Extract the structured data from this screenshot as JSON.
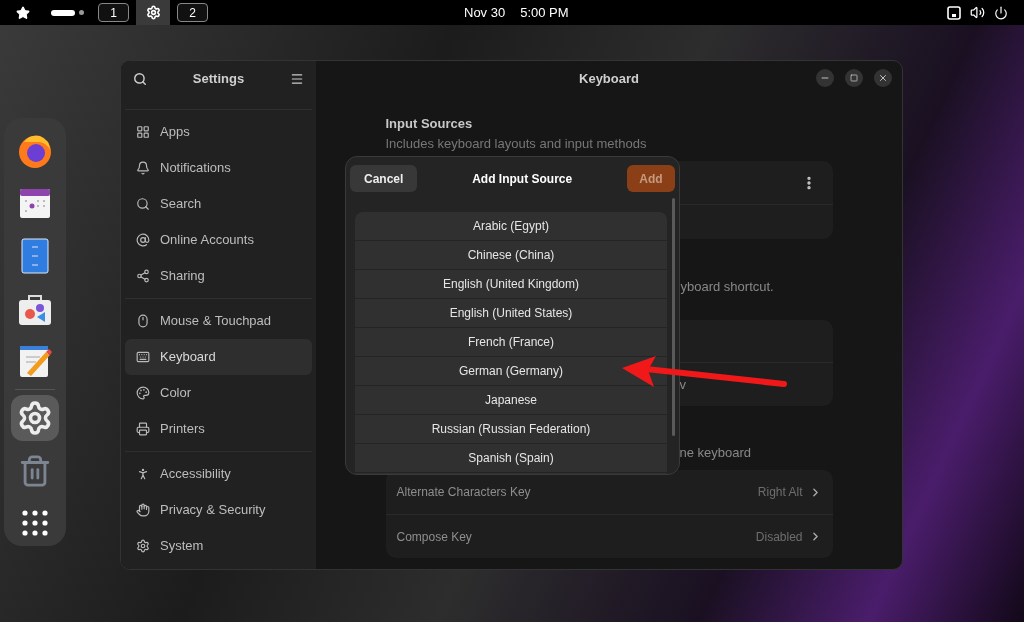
{
  "top_bar": {
    "workspace_dots": [
      {
        "selected": true
      },
      {
        "selected": false
      }
    ],
    "workspaces": [
      {
        "kind": "number",
        "label": "1",
        "selected": false
      },
      {
        "kind": "app",
        "selected": true
      },
      {
        "kind": "number",
        "label": "2",
        "selected": false
      }
    ],
    "date": "Nov 30",
    "time": "5:00 PM"
  },
  "dock": {
    "items": [
      {
        "kind": "browser",
        "selected": false
      },
      {
        "kind": "calendar",
        "selected": false
      },
      {
        "kind": "notes",
        "selected": false
      },
      {
        "kind": "store",
        "selected": false
      },
      {
        "kind": "editor",
        "selected": false
      },
      {
        "kind": "settings",
        "selected": true
      },
      {
        "kind": "trash",
        "selected": false
      },
      {
        "kind": "app-grid",
        "selected": false
      }
    ]
  },
  "sidebar": {
    "title": "Settings",
    "groups": [
      [
        {
          "label": "Apps",
          "kind": "apps",
          "selected": false
        },
        {
          "label": "Notifications",
          "kind": "bell",
          "selected": false
        },
        {
          "label": "Search",
          "kind": "search",
          "selected": false
        },
        {
          "label": "Online Accounts",
          "kind": "at",
          "selected": false
        },
        {
          "label": "Sharing",
          "kind": "share",
          "selected": false
        }
      ],
      [
        {
          "label": "Mouse & Touchpad",
          "kind": "mouse",
          "selected": false
        },
        {
          "label": "Keyboard",
          "kind": "keyboard",
          "selected": true
        },
        {
          "label": "Color",
          "kind": "color",
          "selected": false
        },
        {
          "label": "Printers",
          "kind": "printer",
          "selected": false
        }
      ],
      [
        {
          "label": "Accessibility",
          "kind": "person",
          "selected": false
        },
        {
          "label": "Privacy & Security",
          "kind": "hand",
          "selected": false
        },
        {
          "label": "System",
          "kind": "gear",
          "selected": false
        }
      ]
    ]
  },
  "window": {
    "title": "Keyboard"
  },
  "content": {
    "input_sources": {
      "heading": "Input Sources",
      "description": "Includes keyboard layouts and input methods"
    },
    "shortcut_fragment": "yboard shortcut.",
    "switch_row_fragment": "v",
    "special_keys_fragment": "ne keyboard",
    "special_keys": [
      {
        "label": "Alternate Characters Key",
        "value": "Right Alt"
      },
      {
        "label": "Compose Key",
        "value": "Disabled"
      }
    ]
  },
  "dialog": {
    "title": "Add Input Source",
    "cancel": "Cancel",
    "add": {
      "label": "Add",
      "disabled": true
    },
    "languages": [
      "Arabic (Egypt)",
      "Chinese (China)",
      "English (United Kingdom)",
      "English (United States)",
      "French (France)",
      "German (Germany)",
      "Japanese",
      "Russian (Russian Federation)",
      "Spanish (Spain)"
    ]
  }
}
